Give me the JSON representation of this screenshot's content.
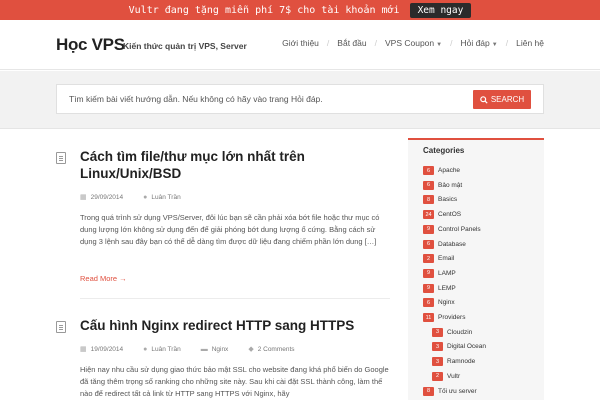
{
  "promo": {
    "text": "Vultr đang tặng miễn phí 7$ cho tài khoản mới",
    "button": "Xem ngay"
  },
  "header": {
    "logo": "Học VPS",
    "tagline": "Kiến thức quản trị VPS, Server",
    "nav": [
      "Giới thiệu",
      "Bắt đầu",
      "VPS Coupon",
      "Hỏi đáp",
      "Liên hệ"
    ]
  },
  "search": {
    "text": "Tìm kiếm bài viết hướng dẫn. Nếu không có hãy vào trang Hỏi đáp.",
    "button": "SEARCH"
  },
  "posts": [
    {
      "title": "Cách tìm file/thư mục lớn nhất trên Linux/Unix/BSD",
      "date": "29/09/2014",
      "author": "Luân Trần",
      "excerpt": "Trong quá trình sử dụng VPS/Server, đôi lúc bạn sẽ cần phải xóa bớt file hoặc thư mục có dung lượng lớn không sử dụng đến để giải phóng bớt dung lượng ổ cứng. Bằng cách sử dụng 3 lệnh sau đây bạn có thể dễ dàng tìm được dữ liệu đang chiếm phần lớn dung […]",
      "readmore": "Read More →"
    },
    {
      "title": "Cấu hình Nginx redirect HTTP sang HTTPS",
      "date": "19/09/2014",
      "author": "Luân Trần",
      "category": "Nginx",
      "comments": "2 Comments",
      "excerpt": "Hiện nay nhu cầu sử dụng giao thức bảo mật SSL cho website đang khá phổ biến do Google đã tăng thêm trọng số ranking cho những site này. Sau khi cài đặt SSL thành công, làm thế nào để redirect tất cả link từ HTTP sang HTTPS với Nginx, hãy"
    }
  ],
  "sidebar": {
    "title": "Categories",
    "categories": [
      {
        "count": "6",
        "name": "Apache"
      },
      {
        "count": "6",
        "name": "Bảo mật"
      },
      {
        "count": "8",
        "name": "Basics"
      },
      {
        "count": "24",
        "name": "CentOS"
      },
      {
        "count": "9",
        "name": "Control Panels"
      },
      {
        "count": "6",
        "name": "Database"
      },
      {
        "count": "2",
        "name": "Email"
      },
      {
        "count": "9",
        "name": "LAMP"
      },
      {
        "count": "9",
        "name": "LEMP"
      },
      {
        "count": "6",
        "name": "Nginx"
      },
      {
        "count": "11",
        "name": "Providers"
      },
      {
        "count": "3",
        "name": "Cloudzin"
      },
      {
        "count": "3",
        "name": "Digital Ocean"
      },
      {
        "count": "3",
        "name": "Ramnode"
      },
      {
        "count": "2",
        "name": "Vultr"
      },
      {
        "count": "8",
        "name": "Tối ưu server"
      }
    ]
  },
  "colors": {
    "accent": "#e0503f",
    "promo_button": "#2b2b2b"
  }
}
